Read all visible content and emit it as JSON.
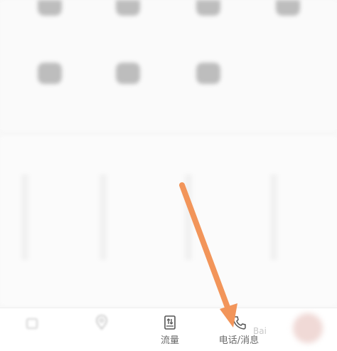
{
  "grid": {
    "items": [
      {
        "icon": "blurred-app-icon",
        "label": ""
      },
      {
        "icon": "blurred-app-icon",
        "label": ""
      },
      {
        "icon": "blurred-app-icon",
        "label": ""
      },
      {
        "icon": "blurred-app-icon",
        "label": ""
      },
      {
        "icon": "blurred-app-icon",
        "label": ""
      },
      {
        "icon": "blurred-app-icon",
        "label": ""
      },
      {
        "icon": "blurred-app-icon",
        "label": ""
      }
    ]
  },
  "tabbar": {
    "tabs": [
      {
        "label": "",
        "icon": "home-icon"
      },
      {
        "label": "",
        "icon": "location-icon"
      },
      {
        "label": "流量",
        "icon": "data-traffic-icon"
      },
      {
        "label": "电话/消息",
        "icon": "phone-icon"
      }
    ]
  },
  "watermark": "Bai",
  "colors": {
    "arrow": "#f2955a",
    "tab_label": "#6a6a6a",
    "background": "#f7f7f7"
  }
}
